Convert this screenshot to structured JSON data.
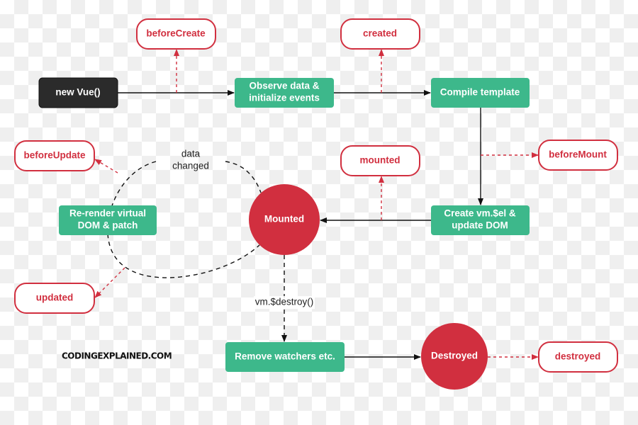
{
  "colors": {
    "step": "#3db88b",
    "hook": "#d12f3f",
    "state": "#d12f3f",
    "start": "#2b2b2b"
  },
  "nodes": {
    "new_vue": "new Vue()",
    "observe": [
      "Observe data &",
      "initialize events"
    ],
    "compile": "Compile template",
    "create_el": [
      "Create vm.$el &",
      "update DOM"
    ],
    "mounted_state": "Mounted",
    "rerender": [
      "Re-render virtual",
      "DOM & patch"
    ],
    "remove_watchers": "Remove watchers etc.",
    "destroyed_state": "Destroyed"
  },
  "hooks": {
    "before_create": "beforeCreate",
    "created": "created",
    "before_mount": "beforeMount",
    "mounted": "mounted",
    "before_update": "beforeUpdate",
    "updated": "updated",
    "destroyed": "destroyed"
  },
  "edge_labels": {
    "data_changed": [
      "data",
      "changed"
    ],
    "destroy_call": "vm.$destroy()"
  },
  "watermark": "CODINGEXPLAINED.COM"
}
